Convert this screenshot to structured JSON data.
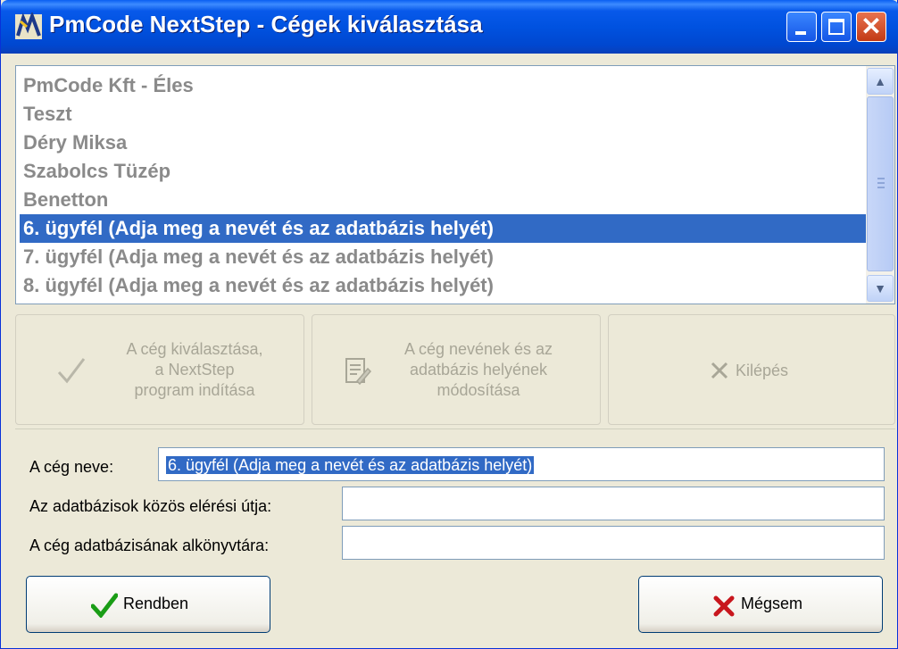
{
  "window": {
    "title": "PmCode NextStep - Cégek kiválasztása",
    "close_glyph": "✕"
  },
  "companies": [
    "PmCode Kft - Éles",
    "Teszt",
    "Déry Miksa",
    "Szabolcs Tüzép",
    "Benetton",
    "6. ügyfél (Adja meg a nevét és az adatbázis helyét)",
    "7. ügyfél (Adja meg a nevét és az adatbázis helyét)",
    "8. ügyfél (Adja meg a nevét és az adatbázis helyét)"
  ],
  "selected_index": 5,
  "actions": {
    "select": [
      "A cég kiválasztása,",
      "a NextStep",
      "program indítása"
    ],
    "modify": [
      "A cég nevének és az",
      "adatbázis helyének",
      "módosítása"
    ],
    "exit": "Kilépés"
  },
  "fields": {
    "company_name_label": "A cég neve:",
    "company_name_value": "6. ügyfél (Adja meg a nevét és az adatbázis helyét)",
    "db_path_label": "Az adatbázisok közös elérési útja:",
    "db_path_value": "",
    "db_subdir_label": "A cég adatbázisának alkönyvtára:",
    "db_subdir_value": ""
  },
  "buttons": {
    "ok": "Rendben",
    "cancel": "Mégsem"
  },
  "icons": {
    "app": "nextstep-app-icon",
    "select_action": "checkmark-icon",
    "modify_action": "edit-document-icon",
    "exit_action": "x-icon",
    "ok": "green-check-icon",
    "cancel": "red-x-icon"
  },
  "colors": {
    "selection": "#316ac5",
    "ok_icon": "#1a9d16",
    "cancel_icon": "#c8161d"
  }
}
